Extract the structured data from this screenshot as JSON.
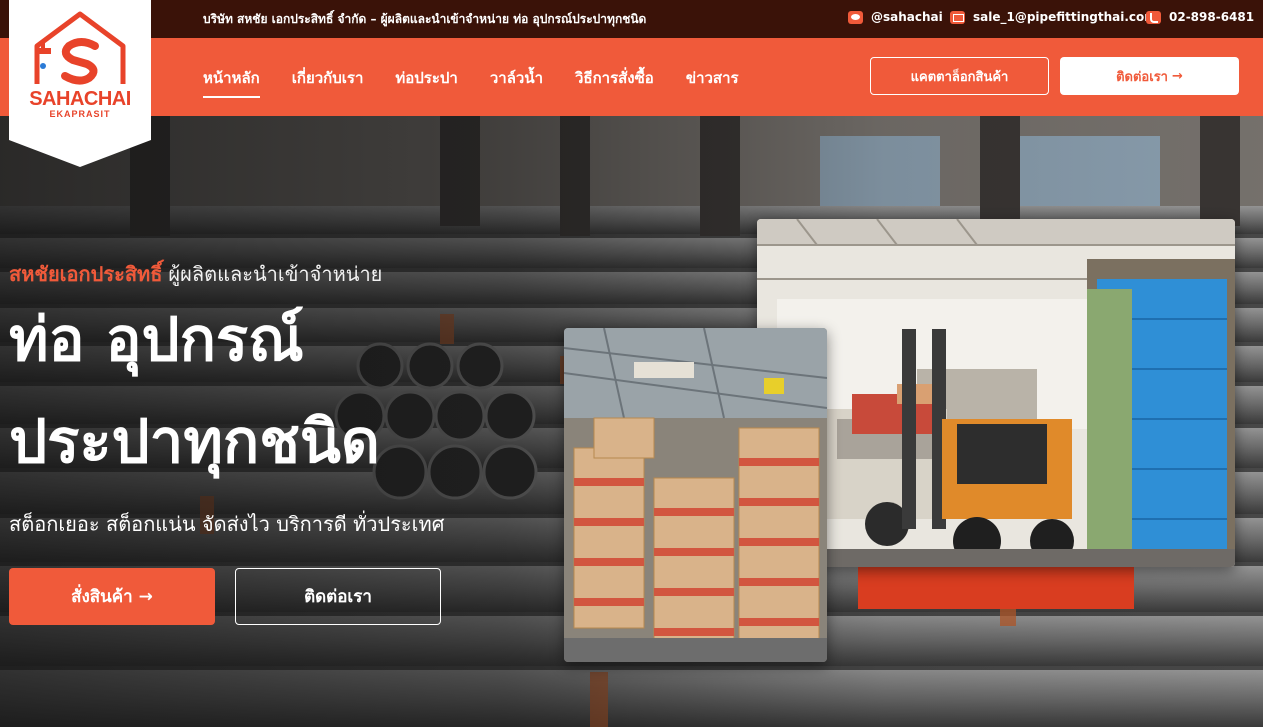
{
  "topbar": {
    "tagline": "บริษัท สหชัย เอกประสิทธิ์ จำกัด – ผู้ผลิตและนำเข้าจำหน่าย ท่อ อุปกรณ์ประปาทุกชนิด",
    "line": "@sahachai",
    "email": "sale_1@pipefittingthai.com",
    "phone": "02-898-6481"
  },
  "logo": {
    "name": "SAHACHAI",
    "sub": "EKAPRASIT"
  },
  "nav": {
    "items": [
      "หน้าหลัก",
      "เกี่ยวกับเรา",
      "ท่อประปา",
      "วาล์วน้ำ",
      "วิธีการสั่งซื้อ",
      "ข่าวสาร"
    ],
    "active_index": 0,
    "catalog_label": "แคตตาล็อกสินค้า",
    "contact_label": "ติดต่อเรา"
  },
  "hero": {
    "kicker_brand": "สหชัยเอกประสิทธิ์",
    "kicker_rest": "ผู้ผลิตและนำเข้าจำหน่าย",
    "title_line1": "ท่อ อุปกรณ์",
    "title_line2": "ประปาทุกชนิด",
    "subtitle": "สต็อกเยอะ สต็อกแน่น จัดส่งไว บริการดี ทั่วประเทศ",
    "order_label": "สั่งสินค้า",
    "contact_label": "ติดต่อเรา"
  },
  "icons": {
    "line": "line-icon",
    "email": "mail-icon",
    "phone": "phone-icon",
    "arrow": "arrow-right-icon"
  },
  "colors": {
    "brand": "#f05a3a",
    "topbar": "#3a1208",
    "accent_dark": "#d93d20"
  }
}
